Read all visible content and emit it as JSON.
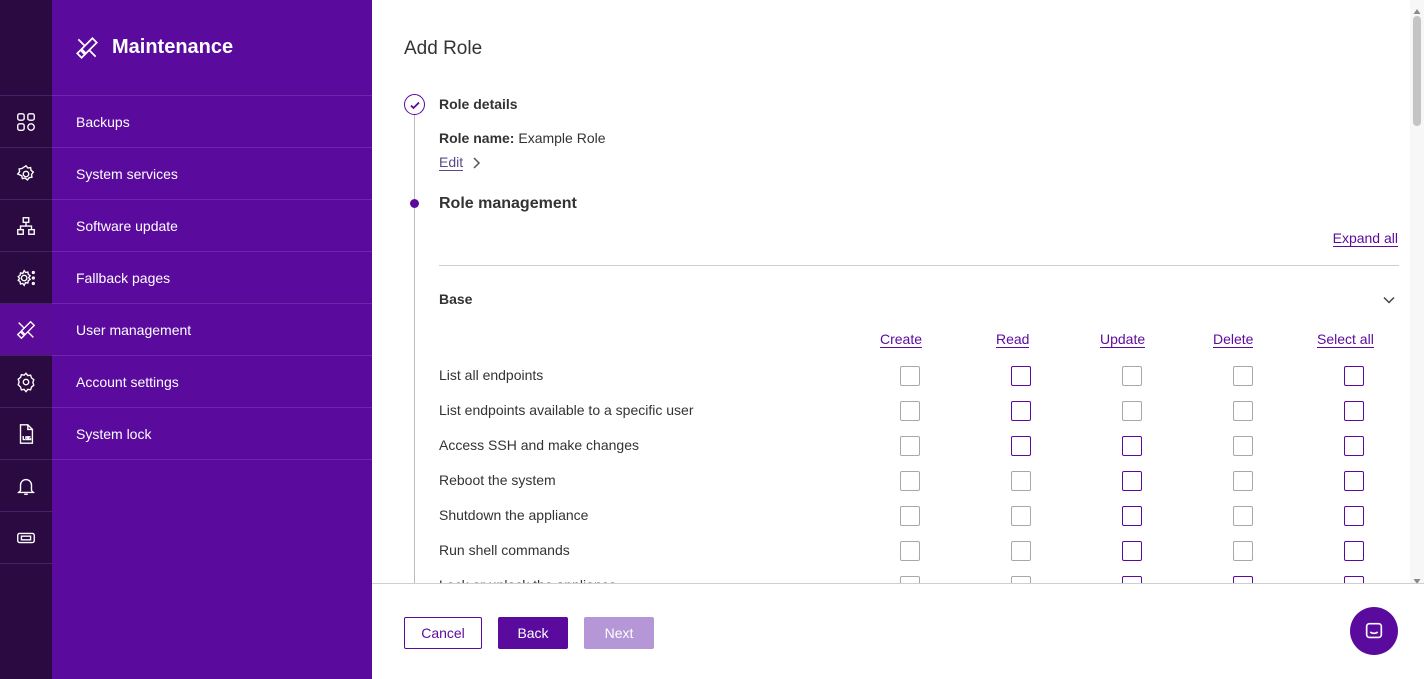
{
  "sidebar": {
    "title": "Maintenance",
    "items": [
      {
        "label": "Backups"
      },
      {
        "label": "System services"
      },
      {
        "label": "Software update"
      },
      {
        "label": "Fallback pages"
      },
      {
        "label": "User management"
      },
      {
        "label": "Account settings"
      },
      {
        "label": "System lock"
      }
    ]
  },
  "rail": {
    "icons": [
      "grid-icon",
      "gear-network-icon",
      "network-icon",
      "gear-dots-icon",
      "tools-icon",
      "gear-icon",
      "log-file-icon",
      "bell-icon",
      "ticket-icon"
    ],
    "active_index": 4
  },
  "main": {
    "title": "Add Role",
    "step1": {
      "title": "Role details",
      "role_name_label": "Role name:",
      "role_name_value": "Example Role",
      "edit_label": "Edit"
    },
    "step2": {
      "title": "Role management",
      "expand_all": "Expand all"
    },
    "section": {
      "title": "Base",
      "columns": [
        "Create",
        "Read",
        "Update",
        "Delete",
        "Select all"
      ],
      "rows": [
        {
          "label": "List all endpoints",
          "checks": [
            false,
            true,
            false,
            false,
            true
          ]
        },
        {
          "label": "List endpoints available to a specific user",
          "checks": [
            false,
            true,
            false,
            false,
            true
          ]
        },
        {
          "label": "Access SSH and make changes",
          "checks": [
            false,
            true,
            true,
            false,
            true
          ]
        },
        {
          "label": "Reboot the system",
          "checks": [
            false,
            false,
            true,
            false,
            true
          ]
        },
        {
          "label": "Shutdown the appliance",
          "checks": [
            false,
            false,
            true,
            false,
            true
          ]
        },
        {
          "label": "Run shell commands",
          "checks": [
            false,
            false,
            true,
            false,
            true
          ]
        },
        {
          "label": "Lock or unlock the appliance",
          "checks": [
            false,
            false,
            true,
            true,
            true
          ]
        }
      ]
    }
  },
  "footer": {
    "cancel": "Cancel",
    "back": "Back",
    "next": "Next"
  },
  "colors": {
    "primary": "#5b0a9e",
    "rail": "#2a0a40",
    "next_disabled": "#b596d6"
  }
}
